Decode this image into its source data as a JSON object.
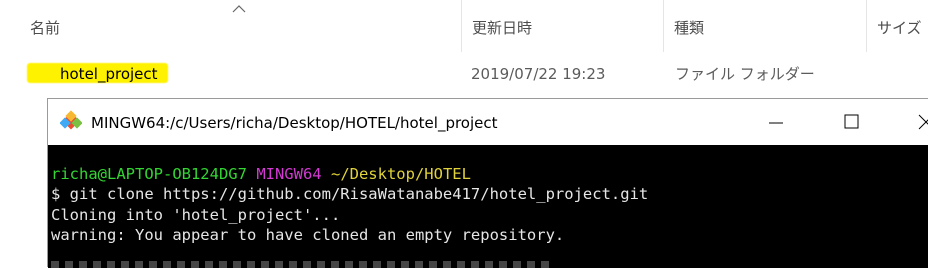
{
  "explorer": {
    "columns": [
      "名前",
      "更新日時",
      "種類",
      "サイズ"
    ],
    "file": {
      "name": "hotel_project",
      "modified": "2019/07/22 19:23",
      "type": "ファイル フォルダー"
    }
  },
  "terminal": {
    "title": "MINGW64:/c/Users/richa/Desktop/HOTEL/hotel_project",
    "prompt_user": "richa@LAPTOP-OB124DG7",
    "prompt_env": "MINGW64",
    "prompt_path": "~/Desktop/HOTEL",
    "command": "$ git clone https://github.com/RisaWatanabe417/hotel_project.git",
    "output": [
      "Cloning into 'hotel_project'...",
      "warning: You appear to have cloned an empty repository."
    ]
  },
  "colors": {
    "highlight": "#fff200",
    "prompt_green": "#33d633",
    "prompt_magenta": "#d23ad2",
    "prompt_yellow": "#e0d23a"
  }
}
